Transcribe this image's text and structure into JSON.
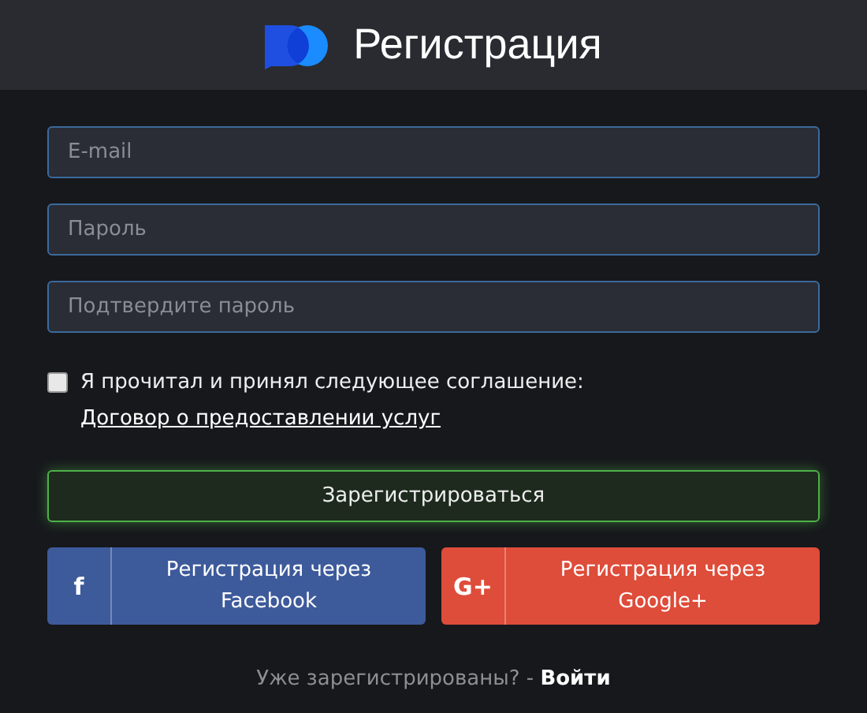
{
  "header": {
    "title": "Регистрация"
  },
  "fields": [
    {
      "placeholder": "E-mail"
    },
    {
      "placeholder": "Пароль"
    },
    {
      "placeholder": "Подтвердите пароль"
    }
  ],
  "agreement": {
    "checked": false,
    "text": "Я прочитал и принял следующее соглашение:",
    "link": "Договор о предоставлении услуг"
  },
  "register_button": "Зарегистрироваться",
  "social_buttons": [
    {
      "kind": "facebook",
      "icon": "f",
      "label": "Регистрация через Facebook"
    },
    {
      "kind": "google",
      "icon": "G+",
      "label": "Регистрация через Google+"
    }
  ],
  "footer": {
    "text": "Уже зарегистрированы? -",
    "link": "Войти"
  }
}
